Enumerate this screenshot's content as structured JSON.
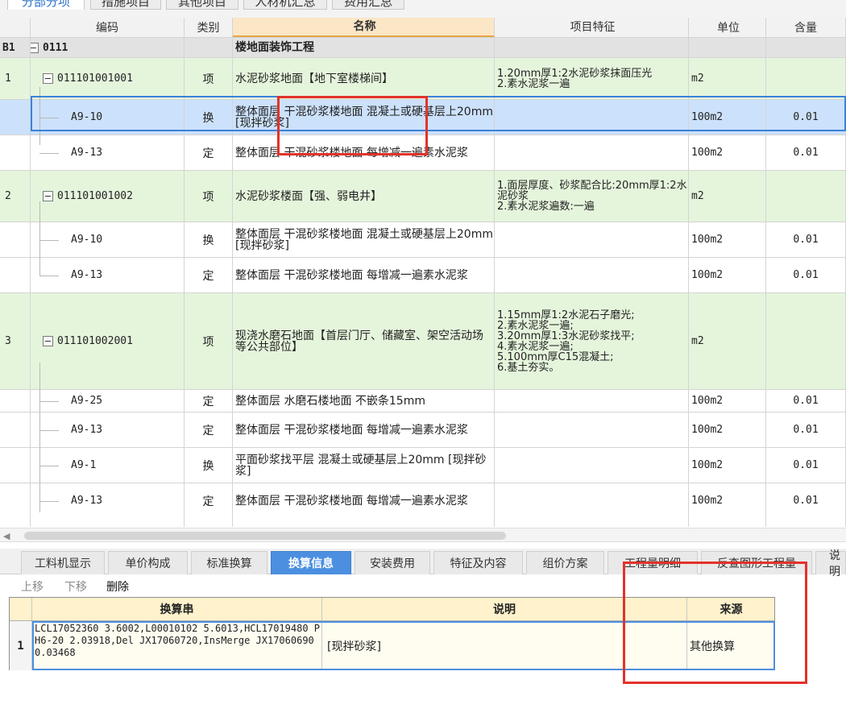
{
  "top_tabs": [
    {
      "label": "分部分项",
      "active": true
    },
    {
      "label": "措施项目",
      "active": false
    },
    {
      "label": "其他项目",
      "active": false
    },
    {
      "label": "人材机汇总",
      "active": false
    },
    {
      "label": "费用汇总",
      "active": false
    }
  ],
  "grid": {
    "columns": {
      "code": "编码",
      "type": "类别",
      "name": "名称",
      "feature": "项目特征",
      "unit": "单位",
      "qty": "含量"
    },
    "group": {
      "index": "B1",
      "code": "0111",
      "name": "楼地面装饰工程"
    },
    "rows": [
      {
        "index": "1",
        "code": "011101001001",
        "type": "项",
        "name": "水泥砂浆地面【地下室楼梯间】",
        "feature": "1.20mm厚1:2水泥砂浆抹面压光\n2.素水泥浆一遍",
        "unit": "m2",
        "qty": ""
      },
      {
        "index": "",
        "code": "A9-10",
        "type": "换",
        "name": "整体面层 干混砂浆楼地面 混凝土或硬基层上20mm  [现拌砂浆]",
        "feature": "",
        "unit": "100m2",
        "qty": "0.01"
      },
      {
        "index": "",
        "code": "A9-13",
        "type": "定",
        "name": "整体面层 干混砂浆楼地面 每增减一遍素水泥浆",
        "feature": "",
        "unit": "100m2",
        "qty": "0.01"
      },
      {
        "index": "2",
        "code": "011101001002",
        "type": "项",
        "name": "水泥砂浆楼面【强、弱电井】",
        "feature": "1.面层厚度、砂浆配合比:20mm厚1:2水泥砂浆\n2.素水泥浆遍数:一遍",
        "unit": "m2",
        "qty": ""
      },
      {
        "index": "",
        "code": "A9-10",
        "type": "换",
        "name": "整体面层 干混砂浆楼地面 混凝土或硬基层上20mm  [现拌砂浆]",
        "feature": "",
        "unit": "100m2",
        "qty": "0.01"
      },
      {
        "index": "",
        "code": "A9-13",
        "type": "定",
        "name": "整体面层 干混砂浆楼地面 每增减一遍素水泥浆",
        "feature": "",
        "unit": "100m2",
        "qty": "0.01"
      },
      {
        "index": "3",
        "code": "011101002001",
        "type": "项",
        "name": "现浇水磨石地面【首层门厅、储藏室、架空活动场等公共部位】",
        "feature": "1.15mm厚1:2水泥石子磨光;\n2.素水泥浆一遍;\n3.20mm厚1:3水泥砂浆找平;\n4.素水泥浆一遍;\n5.100mm厚C15混凝土;\n6.基土夯实。",
        "unit": "m2",
        "qty": ""
      },
      {
        "index": "",
        "code": "A9-25",
        "type": "定",
        "name": "整体面层 水磨石楼地面 不嵌条15mm",
        "feature": "",
        "unit": "100m2",
        "qty": "0.01"
      },
      {
        "index": "",
        "code": "A9-13",
        "type": "定",
        "name": "整体面层 干混砂浆楼地面 每增减一遍素水泥浆",
        "feature": "",
        "unit": "100m2",
        "qty": "0.01"
      },
      {
        "index": "",
        "code": "A9-1",
        "type": "换",
        "name": "平面砂浆找平层 混凝土或硬基层上20mm  [现拌砂浆]",
        "feature": "",
        "unit": "100m2",
        "qty": "0.01"
      },
      {
        "index": "",
        "code": "A9-13",
        "type": "定",
        "name": "整体面层 干混砂浆楼地面 每增减一遍素水泥浆",
        "feature": "",
        "unit": "100m2",
        "qty": "0.01"
      }
    ]
  },
  "bottom_tabs": [
    {
      "label": "工料机显示",
      "active": false
    },
    {
      "label": "单价构成",
      "active": false
    },
    {
      "label": "标准换算",
      "active": false
    },
    {
      "label": "换算信息",
      "active": true
    },
    {
      "label": "安装费用",
      "active": false
    },
    {
      "label": "特征及内容",
      "active": false
    },
    {
      "label": "组价方案",
      "active": false
    },
    {
      "label": "工程量明细",
      "active": false
    },
    {
      "label": "反查图形工程量",
      "active": false
    },
    {
      "label": "说明",
      "active": false
    }
  ],
  "toolbar": {
    "up": "上移",
    "down": "下移",
    "delete": "删除"
  },
  "conversion": {
    "headers": {
      "string": "换算串",
      "desc": "说明",
      "source": "来源"
    },
    "rows": [
      {
        "index": "1",
        "string": "LCL17052360 3.6002,L00010102 5.6013,HCL17019480 PH6-20 2.03918,Del JX17060720,InsMerge JX17060690 0.03468",
        "desc": "[现拌砂浆]",
        "source": "其他换算"
      }
    ]
  },
  "colors": {
    "selected_row": "#cce1fb",
    "item_row": "#e5f5dc",
    "group_row": "#e2e2e2",
    "active_tab": "#4c8fe0",
    "highlight": "#e3322b"
  }
}
